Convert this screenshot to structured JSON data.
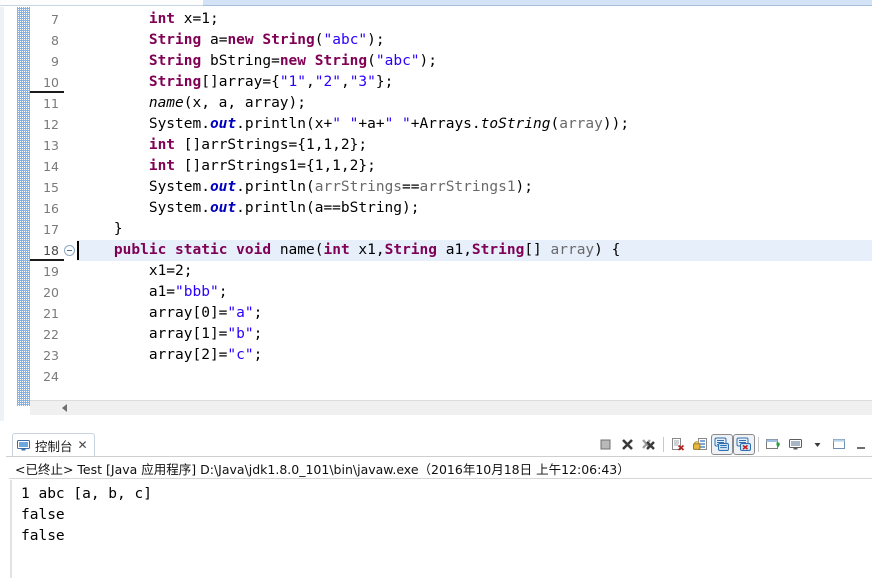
{
  "editor": {
    "first_line_number": 7,
    "highlighted_line": 18,
    "caret_line": 18,
    "fold_marker_line": 18,
    "lines": [
      {
        "n": 7,
        "text": "        int x=1;"
      },
      {
        "n": 8,
        "text": "        String a=new String(\"abc\");"
      },
      {
        "n": 9,
        "text": "        String bString=new String(\"abc\");"
      },
      {
        "n": 10,
        "text": "        String[]array={\"1\",\"2\",\"3\"};"
      },
      {
        "n": 11,
        "text": "        name(x, a, array);"
      },
      {
        "n": 12,
        "text": "        System.out.println(x+\" \"+a+\" \"+Arrays.toString(array));"
      },
      {
        "n": 13,
        "text": "        int []arrStrings={1,1,2};"
      },
      {
        "n": 14,
        "text": "        int []arrStrings1={1,1,2};"
      },
      {
        "n": 15,
        "text": "        System.out.println(arrStrings==arrStrings1);"
      },
      {
        "n": 16,
        "text": "        System.out.println(a==bString);"
      },
      {
        "n": 17,
        "text": "    }"
      },
      {
        "n": 18,
        "text": "    public static void name(int x1,String a1,String[] array) {"
      },
      {
        "n": 19,
        "text": "        x1=2;"
      },
      {
        "n": 20,
        "text": "        a1=\"bbb\";"
      },
      {
        "n": 21,
        "text": "        array[0]=\"a\";"
      },
      {
        "n": 22,
        "text": "        array[1]=\"b\";"
      },
      {
        "n": 23,
        "text": "        array[2]=\"c\";"
      },
      {
        "n": 24,
        "text": ""
      }
    ],
    "scrollbar": {
      "left_arrow": "scroll-left"
    }
  },
  "console": {
    "tab_label": "控制台",
    "tab_icon": "console-monitor-icon",
    "tab_close": "✕",
    "status_line": "<已终止> Test [Java 应用程序] D:\\Java\\jdk1.8.0_101\\bin\\javaw.exe（2016年10月18日 上午12:06:43）",
    "output_lines": [
      "1 abc [a, b, c]",
      "false",
      "false"
    ],
    "toolbar": [
      {
        "name": "terminate-button",
        "pressed": false
      },
      {
        "name": "remove-launch-button",
        "pressed": false
      },
      {
        "name": "remove-all-terminated-button",
        "pressed": false
      },
      {
        "name": "separator-1",
        "pressed": false
      },
      {
        "name": "clear-console-button",
        "pressed": false
      },
      {
        "name": "scroll-lock-button",
        "pressed": false
      },
      {
        "name": "show-console-on-output-button",
        "pressed": true
      },
      {
        "name": "show-console-on-error-button",
        "pressed": true
      },
      {
        "name": "separator-2",
        "pressed": false
      },
      {
        "name": "pin-console-button",
        "pressed": false
      },
      {
        "name": "display-selected-console-button",
        "pressed": false
      },
      {
        "name": "open-console-dropdown",
        "pressed": false
      },
      {
        "name": "view-menu-button",
        "pressed": false
      },
      {
        "name": "minimize-view-button",
        "pressed": false
      }
    ]
  },
  "colors": {
    "keyword": "#7f0055",
    "string": "#2a00ff",
    "static_field": "#0000c0",
    "field": "#6a6a6a",
    "line_highlight": "#e7effb",
    "change_bar": "#5b9bd5",
    "tab_band": "#d3e3f5"
  }
}
